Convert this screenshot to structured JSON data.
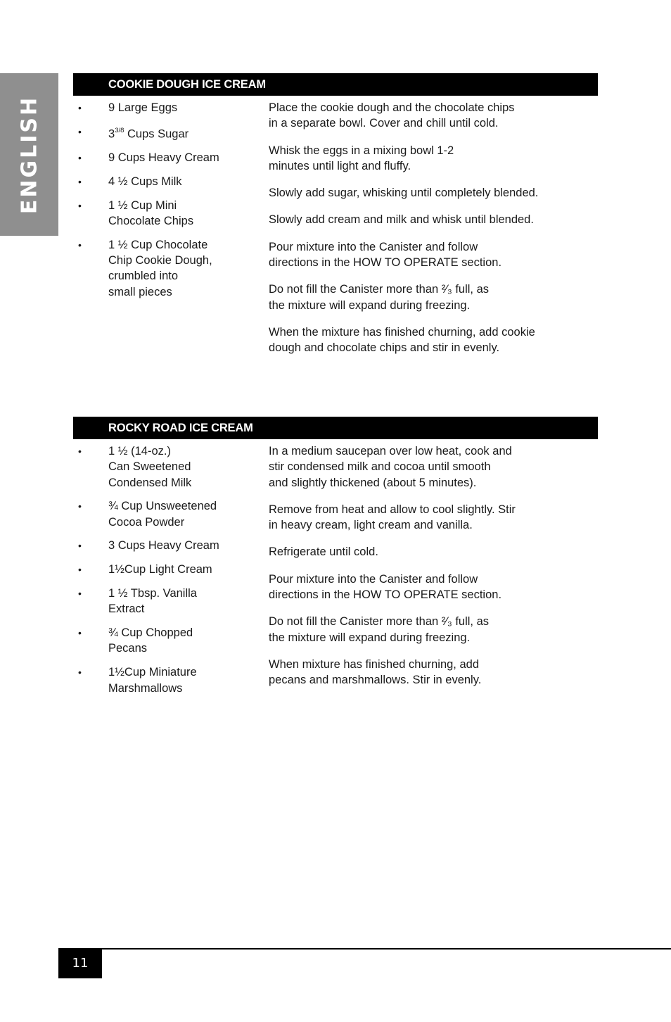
{
  "side_tab": {
    "label": "ENGLISH"
  },
  "recipes": [
    {
      "title": "COOKIE DOUGH ICE CREAM",
      "ingredients": [
        {
          "text": "9 Large Eggs"
        },
        {
          "text_before": "3",
          "superscript": "3/8",
          "text_after": " Cups Sugar"
        },
        {
          "text": "9 Cups Heavy Cream"
        },
        {
          "text": "4 ½ Cups Milk"
        },
        {
          "text": "1 ½ Cup Mini\nChocolate Chips"
        },
        {
          "text": "1 ½ Cup Chocolate\nChip Cookie Dough,\ncrumbled into\nsmall pieces"
        }
      ],
      "steps": [
        "Place the cookie dough and the chocolate chips\nin a separate bowl. Cover and chill until cold.",
        "Whisk the eggs in a mixing bowl 1-2\nminutes until light and fluffy.",
        "Slowly add sugar, whisking until completely blended.",
        "Slowly add cream and milk and whisk until blended.",
        "Pour mixture into the Canister and follow\ndirections in the HOW TO OPERATE section.",
        "Do not fill the Canister more than ²⁄₃ full, as\nthe mixture will expand during freezing.",
        "When the mixture has finished churning, add cookie\ndough and chocolate chips and stir in evenly."
      ]
    },
    {
      "title": "ROCKY ROAD ICE CREAM",
      "ingredients": [
        {
          "text": "1 ½ (14-oz.)\nCan Sweetened\nCondensed Milk"
        },
        {
          "text": "¾ Cup Unsweetened\nCocoa Powder"
        },
        {
          "text": "3 Cups Heavy Cream"
        },
        {
          "text": "1½Cup Light Cream"
        },
        {
          "text": "1 ½ Tbsp. Vanilla\nExtract"
        },
        {
          "text": "¾ Cup Chopped\nPecans"
        },
        {
          "text": "1½Cup Miniature\nMarshmallows"
        }
      ],
      "steps": [
        "In a medium saucepan over low heat, cook and\nstir condensed milk and cocoa until smooth\nand slightly thickened (about 5 minutes).",
        "Remove from heat and allow to cool slightly. Stir\nin heavy cream, light cream and vanilla.",
        "Refrigerate until cold.",
        "Pour mixture into the Canister and follow\ndirections in the HOW TO OPERATE section.",
        "Do not fill the Canister more than ²⁄₃ full, as\nthe mixture will expand during freezing.",
        "When mixture has finished churning, add\npecans and marshmallows. Stir in evenly."
      ]
    }
  ],
  "footer": {
    "page_number": "11"
  },
  "colors": {
    "header_bg": "#000000",
    "side_tab_bg": "#8f8f8f",
    "text": "#1a1a1a"
  }
}
